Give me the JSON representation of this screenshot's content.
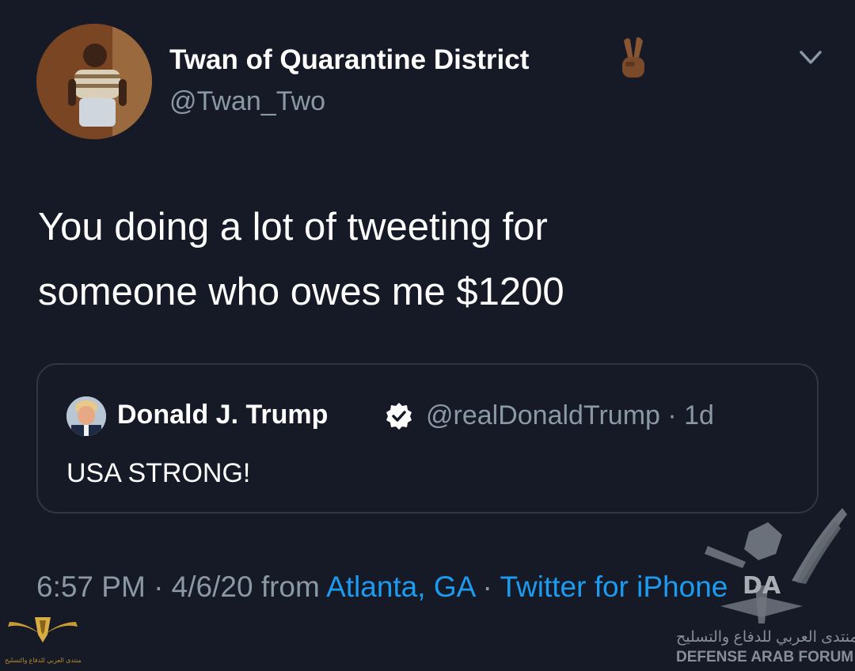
{
  "tweet": {
    "author": {
      "display_name": "Twan of Quarantine District",
      "handle": "@Twan_Two",
      "name_emoji_icon": "victory-hand-icon"
    },
    "menu_icon": "chevron-down-icon",
    "text_lines": [
      "You doing a lot of tweeting for",
      "someone who owes me $1200"
    ],
    "quoted": {
      "display_name": "Donald J. Trump",
      "verified_icon": "verified-badge-icon",
      "meta": "@realDonaldTrump · 1d",
      "text": "USA STRONG!"
    },
    "footer": {
      "time_date": "6:57 PM · 4/6/20 from ",
      "location": "Atlanta, GA",
      "separator": " · ",
      "source": "Twitter for iPhone"
    }
  },
  "watermark": {
    "letters": "DA",
    "arabic": "المنتدى العربي للدفاع والتسليح",
    "english": "DEFENSE ARAB FORUM"
  },
  "colors": {
    "background": "#151a26",
    "text_primary": "#ffffff",
    "text_secondary": "#8b98a5",
    "link": "#1d9bf0",
    "verified": "#ffffff",
    "card_border": "#2f3744"
  }
}
